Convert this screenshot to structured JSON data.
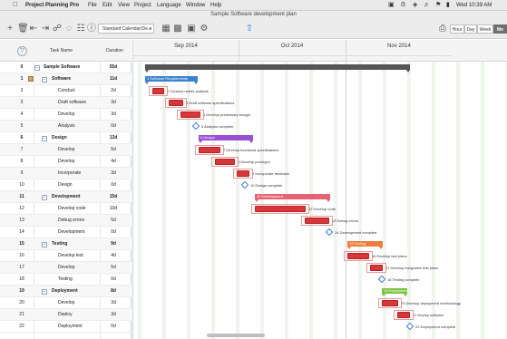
{
  "menubar": {
    "apple_icon": "apple-logo-icon",
    "app_name": "Project Planning Pro",
    "menus": [
      "File",
      "Edit",
      "View",
      "Project",
      "Language",
      "Window",
      "Help"
    ],
    "clock": "Wed 10:39 AM"
  },
  "window": {
    "title": "Sample Software development plan"
  },
  "toolbar": {
    "calendar_select": "Standard Calendar(De...",
    "view_modes": [
      "Hour",
      "Day",
      "Week",
      "Mo"
    ],
    "active_view": "Mo"
  },
  "grid": {
    "headers": {
      "task_name": "Task Name",
      "duration": "Duration"
    },
    "rows": [
      {
        "id": "0",
        "name": "Sample Software",
        "duration": "55d",
        "level": 0,
        "summary": true
      },
      {
        "id": "1",
        "name": "Software",
        "duration": "11d",
        "level": 1,
        "summary": true,
        "note": true
      },
      {
        "id": "2",
        "name": "Conduct",
        "duration": "2d",
        "level": 2,
        "summary": false
      },
      {
        "id": "3",
        "name": "Draft software",
        "duration": "3d",
        "level": 2,
        "summary": false
      },
      {
        "id": "4",
        "name": "Develop",
        "duration": "3d",
        "level": 2,
        "summary": false
      },
      {
        "id": "5",
        "name": "Analysis",
        "duration": "0d",
        "level": 2,
        "summary": false
      },
      {
        "id": "6",
        "name": "Design",
        "duration": "12d",
        "level": 1,
        "summary": true
      },
      {
        "id": "7",
        "name": "Develop",
        "duration": "5d",
        "level": 2,
        "summary": false
      },
      {
        "id": "8",
        "name": "Develop",
        "duration": "4d",
        "level": 2,
        "summary": false
      },
      {
        "id": "9",
        "name": "Incorporate",
        "duration": "3d",
        "level": 2,
        "summary": false
      },
      {
        "id": "10",
        "name": "Design",
        "duration": "0d",
        "level": 2,
        "summary": false
      },
      {
        "id": "11",
        "name": "Development",
        "duration": "15d",
        "level": 1,
        "summary": true
      },
      {
        "id": "12",
        "name": "Develop code",
        "duration": "10d",
        "level": 2,
        "summary": false
      },
      {
        "id": "13",
        "name": "Debug errors",
        "duration": "5d",
        "level": 2,
        "summary": false
      },
      {
        "id": "14",
        "name": "Development",
        "duration": "0d",
        "level": 2,
        "summary": false
      },
      {
        "id": "15",
        "name": "Testing",
        "duration": "9d",
        "level": 1,
        "summary": true
      },
      {
        "id": "16",
        "name": "Develop test",
        "duration": "4d",
        "level": 2,
        "summary": false
      },
      {
        "id": "17",
        "name": "Develop",
        "duration": "5d",
        "level": 2,
        "summary": false
      },
      {
        "id": "18",
        "name": "Testing",
        "duration": "0d",
        "level": 2,
        "summary": false
      },
      {
        "id": "19",
        "name": "Deployment",
        "duration": "8d",
        "level": 1,
        "summary": true
      },
      {
        "id": "20",
        "name": "Develop",
        "duration": "3d",
        "level": 2,
        "summary": false
      },
      {
        "id": "21",
        "name": "Deploy",
        "duration": "3d",
        "level": 2,
        "summary": false
      },
      {
        "id": "22",
        "name": "Deployment",
        "duration": "0d",
        "level": 2,
        "summary": false
      }
    ]
  },
  "timeline": {
    "months": [
      "Sep 2014",
      "Oct 2014",
      "Nov 2014"
    ],
    "colors": {
      "task": "#d9363a",
      "project": "#555555",
      "software": "#3b83cf",
      "design": "#9a4fd6",
      "development": "#e86276",
      "testing": "#ee7d3a",
      "deployment": "#7cc242",
      "milestone": "#3a7bd5"
    },
    "bars": [
      {
        "row": 0,
        "kind": "project",
        "label": ""
      },
      {
        "row": 1,
        "kind": "software",
        "label": "1 Software Requirements"
      },
      {
        "row": 2,
        "kind": "task",
        "label": "2 Conduct needs analysis"
      },
      {
        "row": 3,
        "kind": "task",
        "label": "3 Draft software specifications"
      },
      {
        "row": 4,
        "kind": "task",
        "label": "4 Develop preliminary budget"
      },
      {
        "row": 5,
        "kind": "milestone",
        "label": "5 Analysis complete"
      },
      {
        "row": 6,
        "kind": "design",
        "label": "6 Design"
      },
      {
        "row": 7,
        "kind": "task",
        "label": "7 Develop functional specifications"
      },
      {
        "row": 8,
        "kind": "task",
        "label": "8 Develop prototype"
      },
      {
        "row": 9,
        "kind": "task",
        "label": "9 Incorporate feedback"
      },
      {
        "row": 10,
        "kind": "milestone",
        "label": "10 Design complete"
      },
      {
        "row": 11,
        "kind": "development",
        "label": "11 Development"
      },
      {
        "row": 12,
        "kind": "task",
        "label": "12 Develop code"
      },
      {
        "row": 13,
        "kind": "task",
        "label": "13 Debug errors"
      },
      {
        "row": 14,
        "kind": "milestone",
        "label": "14 Development complete"
      },
      {
        "row": 15,
        "kind": "testing",
        "label": "15 Testing"
      },
      {
        "row": 16,
        "kind": "task",
        "label": "16 Develop test plans"
      },
      {
        "row": 17,
        "kind": "task",
        "label": "17 Develop integration test plans"
      },
      {
        "row": 18,
        "kind": "milestone",
        "label": "18 Testing complete"
      },
      {
        "row": 19,
        "kind": "deployment",
        "label": "19 Deployment"
      },
      {
        "row": 20,
        "kind": "task",
        "label": "20 Develop deployment methodology"
      },
      {
        "row": 21,
        "kind": "task",
        "label": "21 Deploy software"
      },
      {
        "row": 22,
        "kind": "milestone",
        "label": "22 Deployment complete"
      }
    ]
  }
}
